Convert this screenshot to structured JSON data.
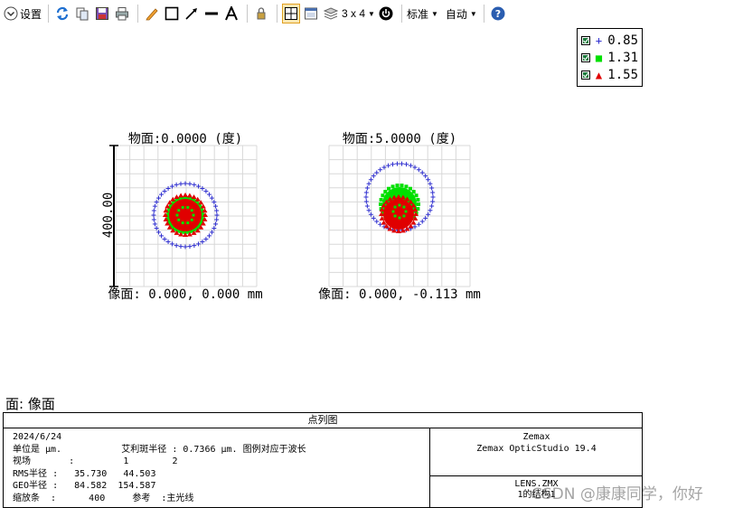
{
  "toolbar": {
    "settings_label": "设置",
    "layout_label": "3 x 4",
    "standard_label": "标准",
    "auto_label": "自动"
  },
  "legend": [
    {
      "symbol": "+",
      "color": "#3030d0",
      "value": "0.85"
    },
    {
      "symbol": "■",
      "color": "#00e000",
      "value": "1.31"
    },
    {
      "symbol": "▲",
      "color": "#e00000",
      "value": "1.55"
    }
  ],
  "plots": [
    {
      "title": "物面:0.0000 (度)",
      "image_label": "像面: 0.000, 0.000 mm"
    },
    {
      "title": "物面:5.0000 (度)",
      "image_label": "像面: 0.000, -0.113 mm"
    }
  ],
  "scale_label": "400.00",
  "field_label": "面: 像面",
  "info": {
    "title": "点列图",
    "lines": [
      "2024/6/24",
      "单位是 µm.           艾利斑半径 : 0.7366 µm. 图例对应于波长",
      "视场       :         1        2",
      "RMS半径 :   35.730   44.503",
      "GEO半径 :   84.582  154.587",
      "缩放条  :      400     参考  :主光线"
    ],
    "right_top": [
      "Zemax",
      "Zemax OpticStudio 19.4"
    ],
    "right_bottom": [
      "LENS.ZMX",
      "1的结构1"
    ]
  },
  "watermark": "CSDN @康康同学，你好",
  "colors": {
    "blue": "#3030d0",
    "green": "#00e000",
    "red": "#e00000",
    "grid": "#d8d8d8"
  }
}
